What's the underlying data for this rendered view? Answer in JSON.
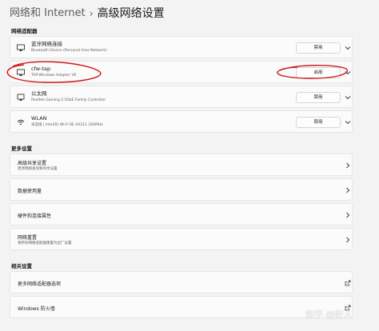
{
  "breadcrumb": {
    "parent": "网络和 Internet",
    "separator": "›",
    "current": "高级网络设置"
  },
  "sections": {
    "adapters": "网络适配器",
    "more": "更多设置",
    "related": "相关设置"
  },
  "adapters": [
    {
      "name": "蓝牙网络连接",
      "description": "Bluetooth Device (Personal Area Network)",
      "button": "禁用",
      "icon": "bluetooth-adapter-icon"
    },
    {
      "name": "cfw-tap",
      "description": "TAP-Windows Adapter V9",
      "button": "启用",
      "icon": "network-adapter-icon"
    },
    {
      "name": "以太网",
      "description": "Realtek Gaming 2.5GbE Family Controller",
      "button": "禁用",
      "icon": "ethernet-icon"
    },
    {
      "name": "WLAN",
      "description": "未连接 | Intel(R) Wi-Fi 6E AX211 160MHz",
      "button": "禁用",
      "icon": "wifi-icon"
    }
  ],
  "more_settings": [
    {
      "title": "高级共享设置",
      "subtitle": "更改网络发现和共享设置"
    },
    {
      "title": "数据使用量",
      "subtitle": ""
    },
    {
      "title": "硬件和连接属性",
      "subtitle": ""
    },
    {
      "title": "网络重置",
      "subtitle": "将所有网络适配器重置为出厂设置"
    }
  ],
  "related_settings": [
    {
      "title": "更多网络适配器选项",
      "icon": "external-link-icon"
    },
    {
      "title": "Windows 防火墙",
      "icon": "external-link-icon"
    }
  ],
  "watermark": "知乎 @好人",
  "colors": {
    "background": "#f3f3f3",
    "card": "#fbfbfb",
    "annotation": "#d01818"
  }
}
